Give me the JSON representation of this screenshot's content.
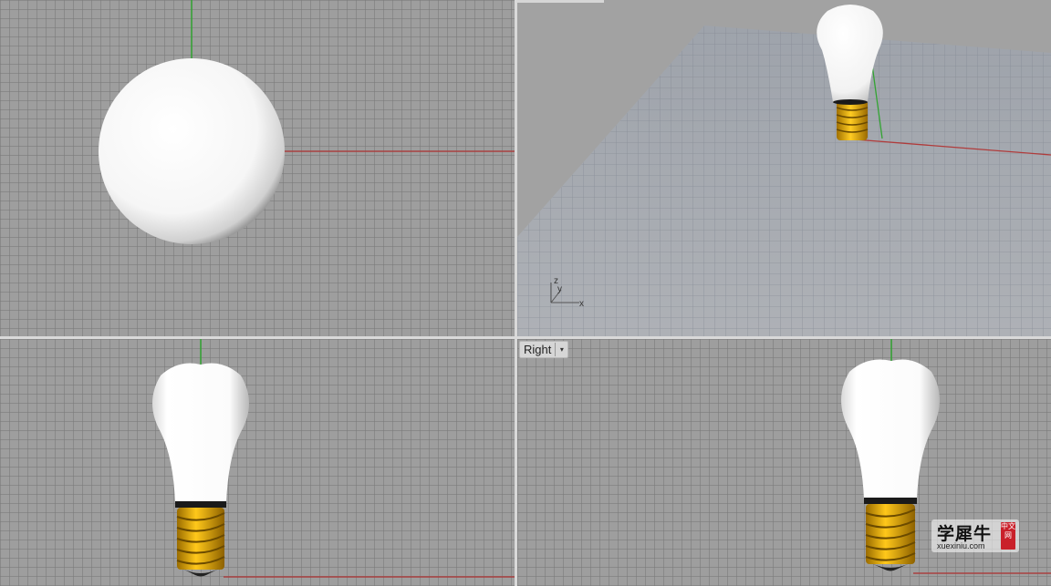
{
  "viewports": {
    "top": {
      "label": ""
    },
    "perspective": {
      "label": ""
    },
    "front": {
      "label": ""
    },
    "right": {
      "label": "Right"
    }
  },
  "axis_icon": {
    "z": "z",
    "y": "y",
    "x": "x"
  },
  "watermark": {
    "main": "学犀牛",
    "sub": "xuexiniu.com",
    "seal": "中文网"
  },
  "colors": {
    "grid_bg": "#9e9e9e",
    "x_axis": "#a83a3a",
    "y_axis": "#3aa83a",
    "bulb_glass": "#ffffff",
    "bulb_base": "#f0b800"
  }
}
